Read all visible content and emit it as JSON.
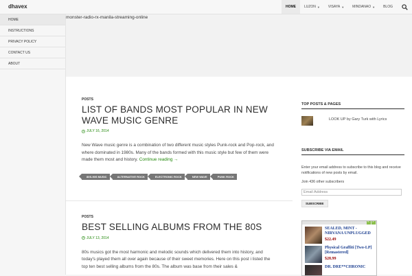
{
  "site": {
    "title": "dhavex"
  },
  "nav": {
    "items": [
      {
        "label": "HOME",
        "dropdown": false
      },
      {
        "label": "LUZON",
        "dropdown": true
      },
      {
        "label": "VISAYA",
        "dropdown": true
      },
      {
        "label": "MINDANAO",
        "dropdown": true
      },
      {
        "label": "BLOG",
        "dropdown": false
      }
    ],
    "caret": "▼",
    "search_icon": "search-icon"
  },
  "sidebar": {
    "items": [
      {
        "label": "HOME"
      },
      {
        "label": "INSTRUCTIONS"
      },
      {
        "label": "PRIVACY POLICY"
      },
      {
        "label": "CONTACT US"
      },
      {
        "label": "ABOUT"
      }
    ]
  },
  "header": {
    "slug": "monster-radio-rx-manila-streaming-online"
  },
  "posts": [
    {
      "category": "POSTS",
      "title": "LIST OF BANDS MOST POPULAR IN NEW WAVE MUSIC GENRE",
      "date": "JULY 16, 2014",
      "excerpt": "New Wave music genre is a combination of two different music styles Punk-rock and Pop-rock, and where dominated in 1980s. Many of the bands formed with this music style but few of them were made them most and history.",
      "more_link": "Continue reading →",
      "tags": [
        "80S-90S MUSIC",
        "ALTERNATIVE ROCK",
        "ELECTRONIC ROCK",
        "NEW WAVE",
        "PUNK ROCK"
      ]
    },
    {
      "category": "POSTS",
      "title": "BEST SELLING ALBUMS FROM THE 80S",
      "date": "JULY 13, 2014",
      "excerpt": "80s musics got the most harmonic and melodic sounds which delivered them into history, and today's played them all over again because of their sweet memories. Here on this post i listed the top ten best selling albums from the 80s. The album was base from their sales &"
    }
  ],
  "widgets": {
    "top_posts": {
      "title": "TOP POSTS & PAGES",
      "items": [
        {
          "label": "LOOK UP by Gary Turk with Lyrics"
        }
      ]
    },
    "subscribe": {
      "title": "SUBSCRIBE VIA EMAIL",
      "text": "Enter your email address to subscribe to this blog and receive notifications of new posts by email.",
      "count_text": "Join 436 other subscribers",
      "email_placeholder": "Email Address",
      "button": "SUBSCRIBE"
    },
    "amazon": {
      "prev": "«",
      "next": "»",
      "items": [
        {
          "title": "SEALED, MINT - NIRVANA UNPLUGGED",
          "price": "$22.49"
        },
        {
          "title": "Physical Graffiti [Two-LP] [Remastered]",
          "price": "$28.99"
        },
        {
          "title": "DR. DRE**CHRONIC",
          "price": ""
        }
      ]
    }
  },
  "colors": {
    "accent": "#24890d",
    "tag_bg": "#767676",
    "link_blue": "#1a3d8f",
    "price_red": "#990000"
  }
}
